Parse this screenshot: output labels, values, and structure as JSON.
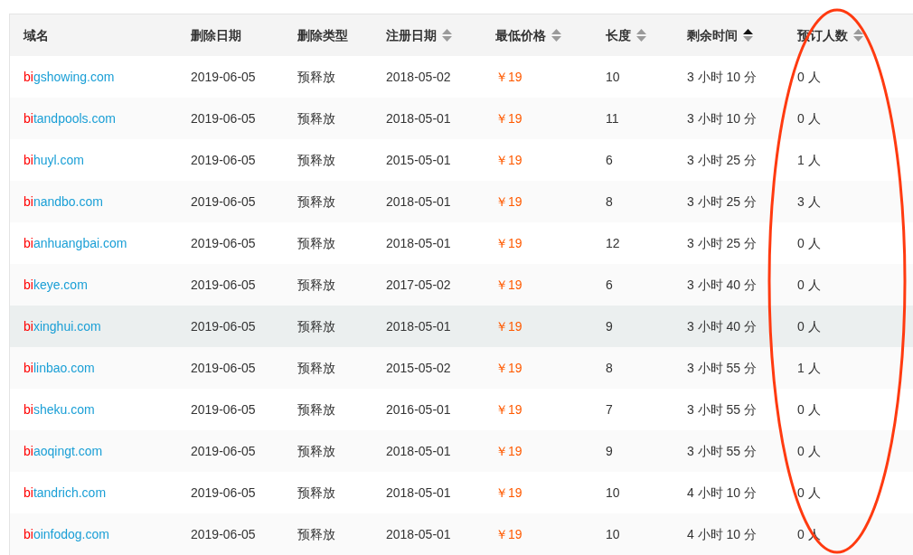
{
  "table": {
    "columns": [
      {
        "label": "域名"
      },
      {
        "label": "删除日期"
      },
      {
        "label": "删除类型"
      },
      {
        "label": "注册日期",
        "sorted_ascending": false
      },
      {
        "label": "最低价格",
        "sorted_ascending": false
      },
      {
        "label": "长度",
        "sorted_ascending": false
      },
      {
        "label": "剩余时间",
        "sorted_ascending": true
      },
      {
        "label": "预订人数",
        "sorted_ascending": false
      }
    ],
    "rows": [
      {
        "domain_prefix": "bi",
        "domain_rest": "gshowing.com",
        "delete_date": "2019-06-05",
        "delete_type": "预释放",
        "reg_date": "2018-05-02",
        "price": "￥19",
        "length": "10",
        "remaining": "3 小时 10 分",
        "reservations": "0 人",
        "highlighted": false
      },
      {
        "domain_prefix": "bi",
        "domain_rest": "tandpools.com",
        "delete_date": "2019-06-05",
        "delete_type": "预释放",
        "reg_date": "2018-05-01",
        "price": "￥19",
        "length": "11",
        "remaining": "3 小时 10 分",
        "reservations": "0 人",
        "highlighted": false
      },
      {
        "domain_prefix": "bi",
        "domain_rest": "huyl.com",
        "delete_date": "2019-06-05",
        "delete_type": "预释放",
        "reg_date": "2015-05-01",
        "price": "￥19",
        "length": "6",
        "remaining": "3 小时 25 分",
        "reservations": "1 人",
        "highlighted": false
      },
      {
        "domain_prefix": "bi",
        "domain_rest": "nandbo.com",
        "delete_date": "2019-06-05",
        "delete_type": "预释放",
        "reg_date": "2018-05-01",
        "price": "￥19",
        "length": "8",
        "remaining": "3 小时 25 分",
        "reservations": "3 人",
        "highlighted": false
      },
      {
        "domain_prefix": "bi",
        "domain_rest": "anhuangbai.com",
        "delete_date": "2019-06-05",
        "delete_type": "预释放",
        "reg_date": "2018-05-01",
        "price": "￥19",
        "length": "12",
        "remaining": "3 小时 25 分",
        "reservations": "0 人",
        "highlighted": false
      },
      {
        "domain_prefix": "bi",
        "domain_rest": "keye.com",
        "delete_date": "2019-06-05",
        "delete_type": "预释放",
        "reg_date": "2017-05-02",
        "price": "￥19",
        "length": "6",
        "remaining": "3 小时 40 分",
        "reservations": "0 人",
        "highlighted": false
      },
      {
        "domain_prefix": "bi",
        "domain_rest": "xinghui.com",
        "delete_date": "2019-06-05",
        "delete_type": "预释放",
        "reg_date": "2018-05-01",
        "price": "￥19",
        "length": "9",
        "remaining": "3 小时 40 分",
        "reservations": "0 人",
        "highlighted": true
      },
      {
        "domain_prefix": "bi",
        "domain_rest": "linbao.com",
        "delete_date": "2019-06-05",
        "delete_type": "预释放",
        "reg_date": "2015-05-02",
        "price": "￥19",
        "length": "8",
        "remaining": "3 小时 55 分",
        "reservations": "1 人",
        "highlighted": false
      },
      {
        "domain_prefix": "bi",
        "domain_rest": "sheku.com",
        "delete_date": "2019-06-05",
        "delete_type": "预释放",
        "reg_date": "2016-05-01",
        "price": "￥19",
        "length": "7",
        "remaining": "3 小时 55 分",
        "reservations": "0 人",
        "highlighted": false
      },
      {
        "domain_prefix": "bi",
        "domain_rest": "aoqingt.com",
        "delete_date": "2019-06-05",
        "delete_type": "预释放",
        "reg_date": "2018-05-01",
        "price": "￥19",
        "length": "9",
        "remaining": "3 小时 55 分",
        "reservations": "0 人",
        "highlighted": false
      },
      {
        "domain_prefix": "bi",
        "domain_rest": "tandrich.com",
        "delete_date": "2019-06-05",
        "delete_type": "预释放",
        "reg_date": "2018-05-01",
        "price": "￥19",
        "length": "10",
        "remaining": "4 小时 10 分",
        "reservations": "0 人",
        "highlighted": false
      },
      {
        "domain_prefix": "bi",
        "domain_rest": "oinfodog.com",
        "delete_date": "2019-06-05",
        "delete_type": "预释放",
        "reg_date": "2018-05-01",
        "price": "￥19",
        "length": "10",
        "remaining": "4 小时 10 分",
        "reservations": "0 人",
        "highlighted": false
      }
    ]
  }
}
